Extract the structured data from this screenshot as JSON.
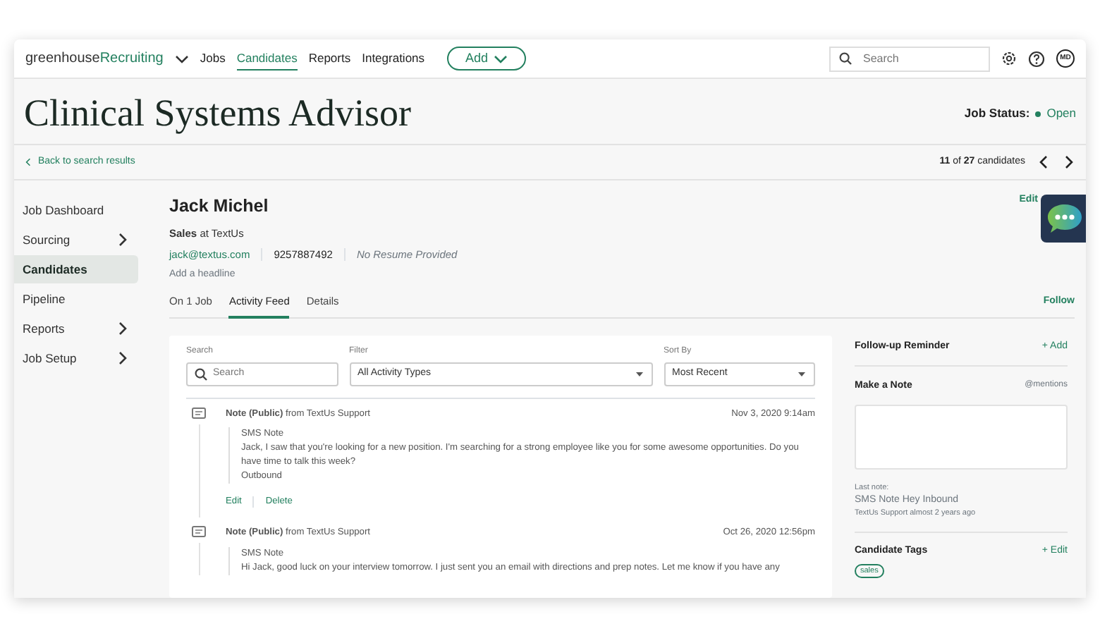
{
  "nav": {
    "brand": "greenhouse",
    "product": "Recruiting",
    "items": [
      {
        "label": "Jobs",
        "selected": false
      },
      {
        "label": "Candidates",
        "selected": true
      },
      {
        "label": "Reports",
        "selected": false
      },
      {
        "label": "Integrations",
        "selected": false
      }
    ],
    "add_button": "Add",
    "search": {
      "placeholder": "Search"
    },
    "avatar": "MD"
  },
  "page": {
    "title": "Clinical Systems Advisor",
    "job_status_label": "Job Status:",
    "job_status": "Open",
    "back_link": "Back to search results",
    "pagination": "**11** of **27** candidates"
  },
  "sidebar": {
    "items": [
      {
        "label": "Job Dashboard",
        "selected": false,
        "has_submenu": false
      },
      {
        "label": "Sourcing",
        "selected": false,
        "has_submenu": true
      },
      {
        "label": "Candidates",
        "selected": true,
        "has_submenu": false
      },
      {
        "label": "Pipeline",
        "selected": false,
        "has_submenu": false
      },
      {
        "label": "Reports",
        "selected": false,
        "has_submenu": true
      },
      {
        "label": "Job Setup",
        "selected": false,
        "has_submenu": true
      }
    ]
  },
  "candidate": {
    "name": "Jack Michel",
    "role": "**Sales** at TextUs",
    "email": "jack@textus.com",
    "phone": "9257887492",
    "resume": "No Resume Provided",
    "headline_prompt": "Add a headline",
    "edit": "Edit"
  },
  "tabs": [
    {
      "label": "On 1 Job",
      "selected": false
    },
    {
      "label": "Activity Feed",
      "selected": true
    },
    {
      "label": "Details",
      "selected": false
    }
  ],
  "follow": "Follow",
  "feed": {
    "search_label": "Search",
    "search_placeholder": "Search",
    "filter_label": "Filter",
    "filter_value": "All Activity Types",
    "sort_label": "Sort By",
    "sort_value": "Most Recent",
    "entries": [
      {
        "title": "Note (Public)",
        "source": "from TextUs Support",
        "date": "Nov 3, 2020 9:14am",
        "lines": [
          "SMS Note",
          "Jack, I saw that you're looking for a new position. I'm searching for a strong employee like you for some awesome opportunities. Do you have time to talk this week?",
          "Outbound"
        ],
        "actions": [
          "Edit",
          "Delete"
        ]
      },
      {
        "title": "Note (Public)",
        "source": "from TextUs Support",
        "date": "Oct 26, 2020 12:56pm",
        "lines": [
          "SMS Note",
          "Hi Jack, good luck on your interview tomorrow. I just sent you an email with directions and prep notes. Let me know if you have any"
        ]
      }
    ]
  },
  "side_panel": {
    "reminder_title": "Follow-up Reminder",
    "reminder_add": "+ Add",
    "note_title": "Make a Note",
    "mentions": "@mentions",
    "last_note_label": "Last note:",
    "last_note": "SMS Note Hey Inbound",
    "last_note_meta": "TextUs Support almost 2 years ago",
    "tags_title": "Candidate Tags",
    "tags_edit": "+ Edit",
    "tags": [
      "sales"
    ]
  }
}
